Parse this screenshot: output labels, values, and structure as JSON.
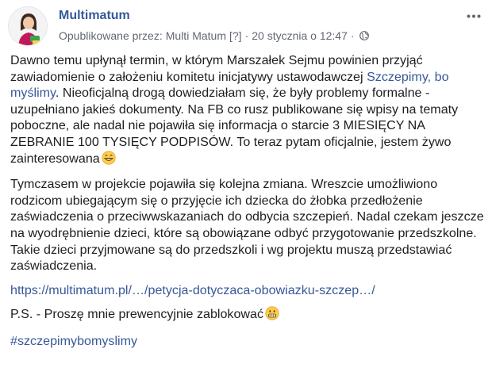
{
  "post": {
    "page_name": "Multimatum",
    "published_by_prefix": "Opublikowane przez:",
    "author": "Multi Matum",
    "help_marker": "[?]",
    "separator": "·",
    "timestamp": "20 stycznia o 12:47",
    "privacy_icon": "globe-icon",
    "more_icon": "ellipsis-icon",
    "avatar_icon": "avatar-illustration",
    "p1_a": "Dawno temu upłynął termin, w którym Marszałek Sejmu powinien przyjąć zawiadomienie o założeniu komitetu inicjatywy ustawodawczej ",
    "p1_link": "Szczepimy, bo myślimy",
    "p1_b": ". Nieoficjalną drogą dowiedziałam się, że były problemy formalne - uzupełniano jakieś dokumenty. Na FB co rusz publikowane się wpisy na tematy poboczne, ale nadal nie pojawiła się informacja o starcie 3 MIESIĘCY NA ZEBRANIE 100 TYSIĘCY PODPISÓW. To teraz pytam oficjalnie, jestem żywo zainteresowana",
    "p1_emoji": "grinning-face-emoji",
    "p2": "Tymczasem w projekcie pojawiła się kolejna zmiana. Wreszcie umożliwiono rodzicom ubiegającym się o przyjęcie ich dziecka do żłobka przedłożenie zaświadczenia o przeciwwskazaniach do odbycia szczepień. Nadal czekam jeszcze na wyodrębnienie dzieci, które są obowiązane odbyć przygotowanie przedszkolne. Takie dzieci przyjmowane są do przedszkoli i wg projektu muszą przedstawiać zaświadczenia.",
    "url_text": "https://multimatum.pl/…/petycja-dotyczaca-obowiazku-szczep…/",
    "ps": "P.S. - Proszę mnie prewencyjnie zablokować",
    "ps_emoji": "grimacing-face-emoji",
    "hashtag": "#szczepimybomyslimy"
  },
  "colors": {
    "link": "#385898",
    "page_name": "#365899",
    "meta_text": "#616770",
    "body_text": "#1c1e21"
  }
}
